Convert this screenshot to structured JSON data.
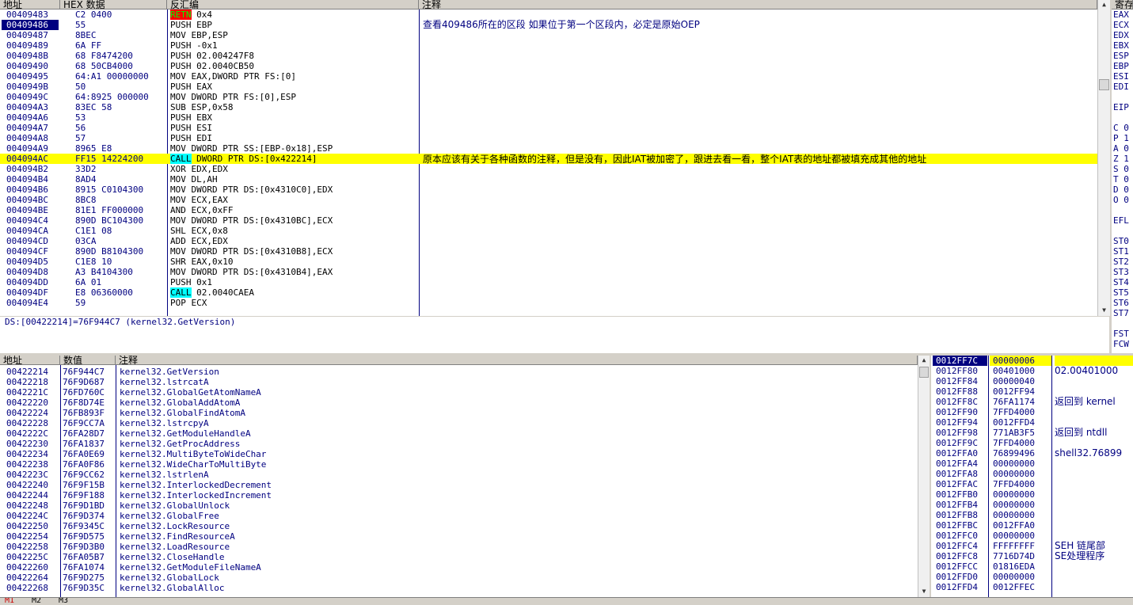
{
  "disasm": {
    "headers": {
      "addr": "地址",
      "hex": "HEX 数据",
      "dis": "反汇编",
      "cmt": "注释"
    },
    "rows": [
      {
        "addr": "00409483",
        "hex": "C2 0400",
        "tag": "RETN",
        "rest": " 0x4",
        "tagtype": "retn"
      },
      {
        "addr": "00409486",
        "hex": "55",
        "dis": "PUSH EBP",
        "sel": true
      },
      {
        "addr": "00409487",
        "hex": "8BEC",
        "dis": "MOV EBP,ESP"
      },
      {
        "addr": "00409489",
        "hex": "6A FF",
        "dis": "PUSH -0x1"
      },
      {
        "addr": "0040948B",
        "hex": "68 F8474200",
        "dis": "PUSH 02.004247F8"
      },
      {
        "addr": "00409490",
        "hex": "68 50CB4000",
        "dis": "PUSH 02.0040CB50"
      },
      {
        "addr": "00409495",
        "hex": "64:A1 00000000",
        "dis": "MOV EAX,DWORD PTR FS:[0]"
      },
      {
        "addr": "0040949B",
        "hex": "50",
        "dis": "PUSH EAX"
      },
      {
        "addr": "0040949C",
        "hex": "64:8925 000000",
        "dis": "MOV DWORD PTR FS:[0],ESP"
      },
      {
        "addr": "004094A3",
        "hex": "83EC 58",
        "dis": "SUB ESP,0x58"
      },
      {
        "addr": "004094A6",
        "hex": "53",
        "dis": "PUSH EBX"
      },
      {
        "addr": "004094A7",
        "hex": "56",
        "dis": "PUSH ESI"
      },
      {
        "addr": "004094A8",
        "hex": "57",
        "dis": "PUSH EDI"
      },
      {
        "addr": "004094A9",
        "hex": "8965 E8",
        "dis": "MOV DWORD PTR SS:[EBP-0x18],ESP"
      },
      {
        "addr": "004094AC",
        "hex": "FF15 14224200",
        "tag": "CALL",
        "rest": " DWORD PTR DS:[0x422214]",
        "tagtype": "call",
        "hl": true
      },
      {
        "addr": "004094B2",
        "hex": "33D2",
        "dis": "XOR EDX,EDX"
      },
      {
        "addr": "004094B4",
        "hex": "8AD4",
        "dis": "MOV DL,AH"
      },
      {
        "addr": "004094B6",
        "hex": "8915 C0104300",
        "dis": "MOV DWORD PTR DS:[0x4310C0],EDX"
      },
      {
        "addr": "004094BC",
        "hex": "8BC8",
        "dis": "MOV ECX,EAX"
      },
      {
        "addr": "004094BE",
        "hex": "81E1 FF000000",
        "dis": "AND ECX,0xFF"
      },
      {
        "addr": "004094C4",
        "hex": "890D BC104300",
        "dis": "MOV DWORD PTR DS:[0x4310BC],ECX"
      },
      {
        "addr": "004094CA",
        "hex": "C1E1 08",
        "dis": "SHL ECX,0x8"
      },
      {
        "addr": "004094CD",
        "hex": "03CA",
        "dis": "ADD ECX,EDX"
      },
      {
        "addr": "004094CF",
        "hex": "890D B8104300",
        "dis": "MOV DWORD PTR DS:[0x4310B8],ECX"
      },
      {
        "addr": "004094D5",
        "hex": "C1E8 10",
        "dis": "SHR EAX,0x10"
      },
      {
        "addr": "004094D8",
        "hex": "A3 B4104300",
        "dis": "MOV DWORD PTR DS:[0x4310B4],EAX"
      },
      {
        "addr": "004094DD",
        "hex": "6A 01",
        "dis": "PUSH 0x1"
      },
      {
        "addr": "004094DF",
        "hex": "E8 06360000",
        "tag": "CALL",
        "rest": " 02.0040CAEA",
        "tagtype": "call"
      },
      {
        "addr": "004094E4",
        "hex": "59",
        "dis": "POP ECX"
      }
    ],
    "note1": "查看409486所在的区段    如果位于第一个区段内，必定是原始OEP",
    "note2": "原本应该有关于各种函数的注释，但是没有，因此IAT被加密了，跟进去看一看，整个IAT表的地址都被填充成其他的地址"
  },
  "info": {
    "line": "DS:[00422214]=76F944C7 (kernel32.GetVersion)"
  },
  "registers": {
    "header": "寄存",
    "items": [
      "EAX",
      "ECX",
      "EDX",
      "EBX",
      "ESP",
      "EBP",
      "ESI",
      "EDI",
      "",
      "EIP",
      "",
      "C 0",
      "P 1",
      "A 0",
      "Z 1",
      "S 0",
      "T 0",
      "D 0",
      "O 0",
      "",
      "EFL",
      "",
      "ST0",
      "ST1",
      "ST2",
      "ST3",
      "ST4",
      "ST5",
      "ST6",
      "ST7",
      "",
      "FST",
      "FCW"
    ]
  },
  "dump": {
    "headers": {
      "addr": "地址",
      "val": "数值",
      "cmt": "注释"
    },
    "rows": [
      {
        "addr": "00422214",
        "val": "76F944C7",
        "cmt": "kernel32.GetVersion"
      },
      {
        "addr": "00422218",
        "val": "76F9D687",
        "cmt": "kernel32.lstrcatA"
      },
      {
        "addr": "0042221C",
        "val": "76FD760C",
        "cmt": "kernel32.GlobalGetAtomNameA"
      },
      {
        "addr": "00422220",
        "val": "76F8D74E",
        "cmt": "kernel32.GlobalAddAtomA"
      },
      {
        "addr": "00422224",
        "val": "76FB893F",
        "cmt": "kernel32.GlobalFindAtomA"
      },
      {
        "addr": "00422228",
        "val": "76F9CC7A",
        "cmt": "kernel32.lstrcpyA"
      },
      {
        "addr": "0042222C",
        "val": "76FA28D7",
        "cmt": "kernel32.GetModuleHandleA"
      },
      {
        "addr": "00422230",
        "val": "76FA1837",
        "cmt": "kernel32.GetProcAddress"
      },
      {
        "addr": "00422234",
        "val": "76FA0E69",
        "cmt": "kernel32.MultiByteToWideChar"
      },
      {
        "addr": "00422238",
        "val": "76FA0F86",
        "cmt": "kernel32.WideCharToMultiByte"
      },
      {
        "addr": "0042223C",
        "val": "76F9CC62",
        "cmt": "kernel32.lstrlenA"
      },
      {
        "addr": "00422240",
        "val": "76F9F15B",
        "cmt": "kernel32.InterlockedDecrement"
      },
      {
        "addr": "00422244",
        "val": "76F9F188",
        "cmt": "kernel32.InterlockedIncrement"
      },
      {
        "addr": "00422248",
        "val": "76F9D1BD",
        "cmt": "kernel32.GlobalUnlock"
      },
      {
        "addr": "0042224C",
        "val": "76F9D374",
        "cmt": "kernel32.GlobalFree"
      },
      {
        "addr": "00422250",
        "val": "76F9345C",
        "cmt": "kernel32.LockResource"
      },
      {
        "addr": "00422254",
        "val": "76F9D575",
        "cmt": "kernel32.FindResourceA"
      },
      {
        "addr": "00422258",
        "val": "76F9D3B0",
        "cmt": "kernel32.LoadResource"
      },
      {
        "addr": "0042225C",
        "val": "76FA05B7",
        "cmt": "kernel32.CloseHandle"
      },
      {
        "addr": "00422260",
        "val": "76FA1074",
        "cmt": "kernel32.GetModuleFileNameA"
      },
      {
        "addr": "00422264",
        "val": "76F9D275",
        "cmt": "kernel32.GlobalLock"
      },
      {
        "addr": "00422268",
        "val": "76F9D35C",
        "cmt": "kernel32.GlobalAlloc"
      }
    ]
  },
  "stack": {
    "rows": [
      {
        "addr": "0012FF7C",
        "val": "00000006",
        "cmt": "",
        "top": true
      },
      {
        "addr": "0012FF80",
        "val": "00401000",
        "cmt": "02.00401000"
      },
      {
        "addr": "0012FF84",
        "val": "00000040",
        "cmt": ""
      },
      {
        "addr": "0012FF88",
        "val": "0012FF94",
        "cmt": ""
      },
      {
        "addr": "0012FF8C",
        "val": "76FA1174",
        "cmt": "返回到 kernel"
      },
      {
        "addr": "0012FF90",
        "val": "7FFD4000",
        "cmt": ""
      },
      {
        "addr": "0012FF94",
        "val": "0012FFD4",
        "cmt": ""
      },
      {
        "addr": "0012FF98",
        "val": "771AB3F5",
        "cmt": "返回到 ntdll"
      },
      {
        "addr": "0012FF9C",
        "val": "7FFD4000",
        "cmt": ""
      },
      {
        "addr": "0012FFA0",
        "val": "76899496",
        "cmt": "shell32.76899"
      },
      {
        "addr": "0012FFA4",
        "val": "00000000",
        "cmt": ""
      },
      {
        "addr": "0012FFA8",
        "val": "00000000",
        "cmt": ""
      },
      {
        "addr": "0012FFAC",
        "val": "7FFD4000",
        "cmt": ""
      },
      {
        "addr": "0012FFB0",
        "val": "00000000",
        "cmt": ""
      },
      {
        "addr": "0012FFB4",
        "val": "00000000",
        "cmt": ""
      },
      {
        "addr": "0012FFB8",
        "val": "00000000",
        "cmt": ""
      },
      {
        "addr": "0012FFBC",
        "val": "0012FFA0",
        "cmt": ""
      },
      {
        "addr": "0012FFC0",
        "val": "00000000",
        "cmt": ""
      },
      {
        "addr": "0012FFC4",
        "val": "FFFFFFFF",
        "cmt": "SEH 链尾部"
      },
      {
        "addr": "0012FFC8",
        "val": "7716D74D",
        "cmt": "SE处理程序"
      },
      {
        "addr": "0012FFCC",
        "val": "01816EDA",
        "cmt": ""
      },
      {
        "addr": "0012FFD0",
        "val": "00000000",
        "cmt": ""
      },
      {
        "addr": "0012FFD4",
        "val": "0012FFEC",
        "cmt": ""
      }
    ]
  },
  "statusbar": {
    "items": [
      "M1",
      "M2",
      "M3"
    ]
  }
}
